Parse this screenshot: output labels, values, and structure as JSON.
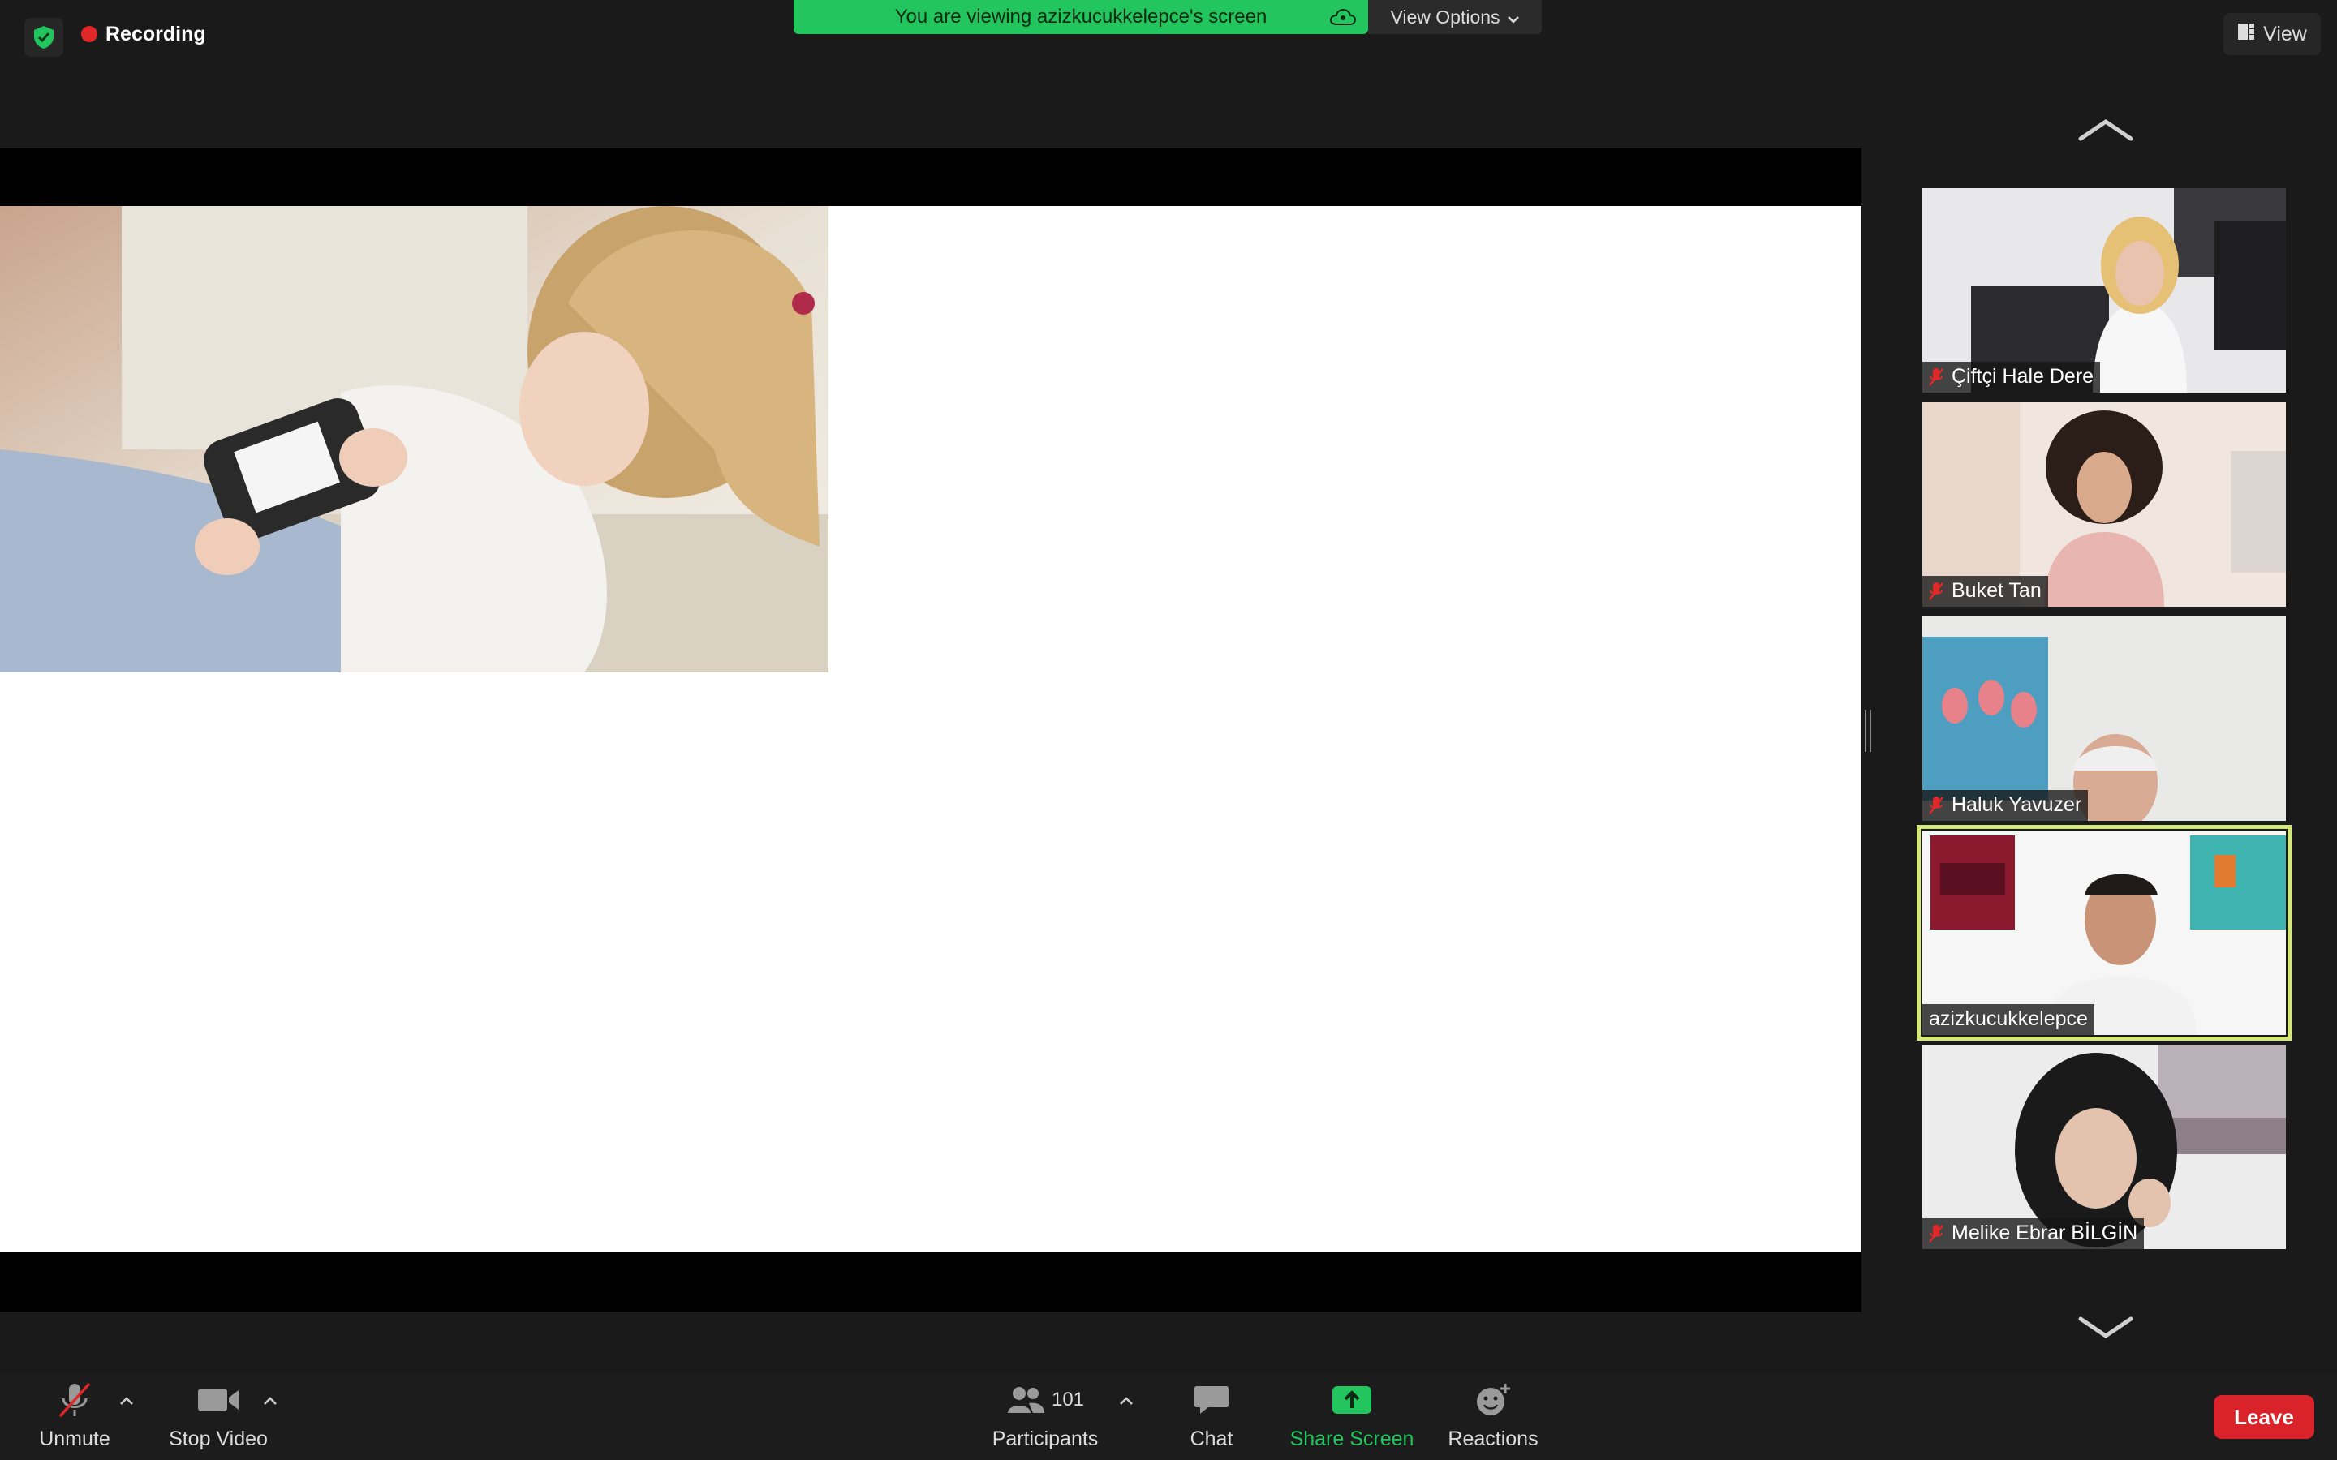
{
  "topbar": {
    "recording_label": "Recording",
    "banner_text": "You are viewing azizkucukkelepce's screen",
    "view_options_label": "View Options",
    "view_label": "View"
  },
  "participants": [
    {
      "name": "Çiftçi Hale Dere",
      "muted": true
    },
    {
      "name": "Buket Tan",
      "muted": true
    },
    {
      "name": "Haluk Yavuzer",
      "muted": true
    },
    {
      "name": "azizkucukkelepce",
      "muted": false,
      "active_speaker": true
    },
    {
      "name": "Melike Ebrar BİLGİN",
      "muted": true
    }
  ],
  "toolbar": {
    "unmute_label": "Unmute",
    "stop_video_label": "Stop Video",
    "participants_label": "Participants",
    "participants_count": "101",
    "chat_label": "Chat",
    "share_screen_label": "Share Screen",
    "reactions_label": "Reactions",
    "leave_label": "Leave"
  },
  "colors": {
    "accent_green": "#22c55e",
    "leave_red": "#d9222a",
    "active_speaker": "#d4e87a"
  }
}
